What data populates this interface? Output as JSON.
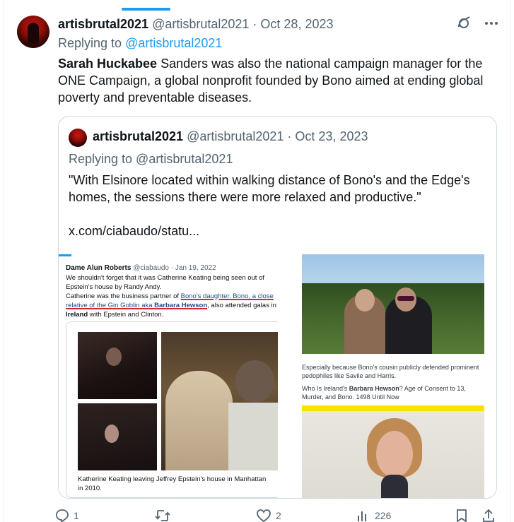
{
  "tweet": {
    "author_name": "artisbrutal2021",
    "author_meta": "@artisbrutal2021 · Oct 28, 2023",
    "replying_prefix": "Replying to",
    "replying_handle": "@artisbrutal2021",
    "text_bold": "Sarah Huckabee",
    "text_rest": " Sanders was also the national campaign manager for the ONE Campaign, a global nonprofit founded by Bono aimed at ending global poverty and preventable diseases."
  },
  "quote": {
    "author_name": "artisbrutal2021",
    "author_meta": "@artisbrutal2021 · Oct 23, 2023",
    "replying": "Replying to @artisbrutal2021",
    "text": "\"With Elsinore located within walking distance of Bono's and the Edge's homes, the sessions there were more relaxed and productive.\"",
    "link": "x.com/ciabaudo/statu..."
  },
  "media_left": {
    "name": "Dame Alun Roberts",
    "meta": "@ciabaudo · Jan 19, 2022",
    "line1": "We shouldn't forget that it was Catherine Keating being seen out of Epstein's house by Randy Andy.",
    "line2_pre": "Catherine was the business partner of ",
    "line2_ul": "Bono's daughter. Bono, a close relative of the Gin Goblin aka ",
    "line2_bold": "Barbara Hewson",
    "line2_post": ", also attended galas in ",
    "line2_bold2": "Ireland",
    "line2_end": " with Epstein and Clinton.",
    "caption": "Katherine Keating leaving Jeffrey Epstein's house in Manhattan in 2010."
  },
  "media_right": {
    "text1": "Especially because Bono's cousin publicly defended prominent pedophiles like Savile and Harris.",
    "text2_pre": "Who Is Ireland's ",
    "text2_bold": "Barbara Hewson",
    "text2_post": "? Age of Consent to 13, Murder, and Bono. 1498 Until Now"
  },
  "actions": {
    "reply_count": "1",
    "retweet_count": "",
    "like_count": "2",
    "views_count": "226"
  },
  "colors": {
    "accent": "#1d9bf0",
    "text": "#0f1419",
    "muted": "#536471",
    "border": "#cfd9de"
  }
}
